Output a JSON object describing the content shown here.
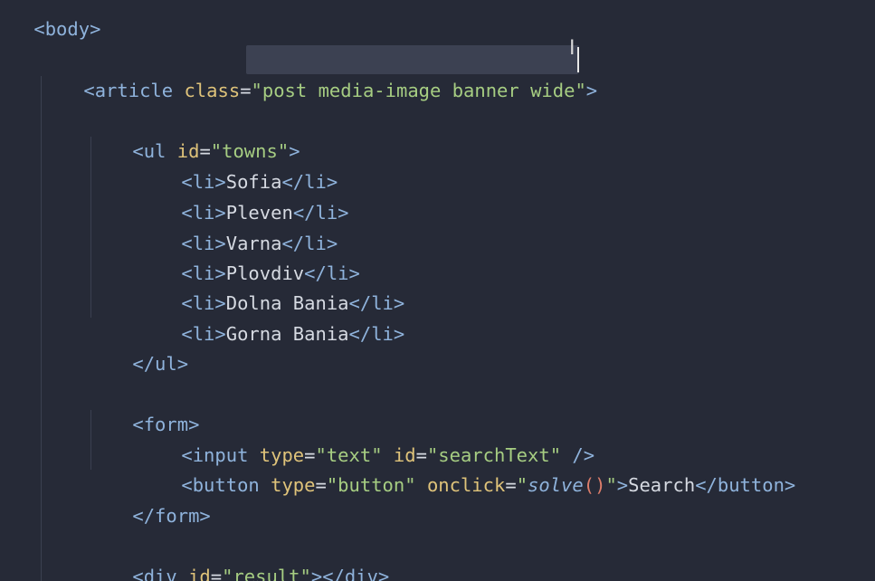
{
  "code": {
    "body_tag": "<body>",
    "article_open_start": "<article",
    "article_attr": "class",
    "article_eq": "=",
    "article_class_value": "\"post media-image banner wide\"",
    "article_open_end": ">",
    "ul_open_start": "<ul",
    "ul_attr": "id",
    "ul_eq": "=",
    "ul_id_value": "\"towns\"",
    "ul_open_end": ">",
    "list_items": [
      {
        "open": "<li>",
        "text": "Sofia",
        "close": "</li>"
      },
      {
        "open": "<li>",
        "text": "Pleven",
        "close": "</li>"
      },
      {
        "open": "<li>",
        "text": "Varna",
        "close": "</li>"
      },
      {
        "open": "<li>",
        "text": "Plovdiv",
        "close": "</li>"
      },
      {
        "open": "<li>",
        "text": "Dolna Bania",
        "close": "</li>"
      },
      {
        "open": "<li>",
        "text": "Gorna Bania",
        "close": "</li>"
      }
    ],
    "ul_close": "</ul>",
    "form_open": "<form>",
    "input_start": "<input",
    "input_type_attr": "type",
    "input_type_value": "\"text\"",
    "input_id_attr": "id",
    "input_id_value": "\"searchText\"",
    "input_end": "/>",
    "button_start": "<button",
    "button_type_attr": "type",
    "button_type_value": "\"button\"",
    "button_onclick_attr": "onclick",
    "button_onclick_quote_open": "\"",
    "button_onclick_fn": "solve",
    "button_onclick_parens": "()",
    "button_onclick_quote_close": "\"",
    "button_open_end": ">",
    "button_text": "Search",
    "button_close": "</button>",
    "form_close": "</form>",
    "div_start": "<div",
    "div_attr": "id",
    "div_id_value": "\"result\"",
    "div_open_end": ">",
    "div_close": "</div>",
    "eq": "="
  },
  "theme": {
    "background": "#262a37",
    "tag_color": "#8fb3dc",
    "attribute_color": "#dfc37a",
    "string_color": "#a6cd82",
    "function_color": "#8fb3dc",
    "paren_color": "#dc7d6a",
    "selection_color": "#3c4152"
  },
  "cursor_icon": "text-cursor-ibeam-icon"
}
